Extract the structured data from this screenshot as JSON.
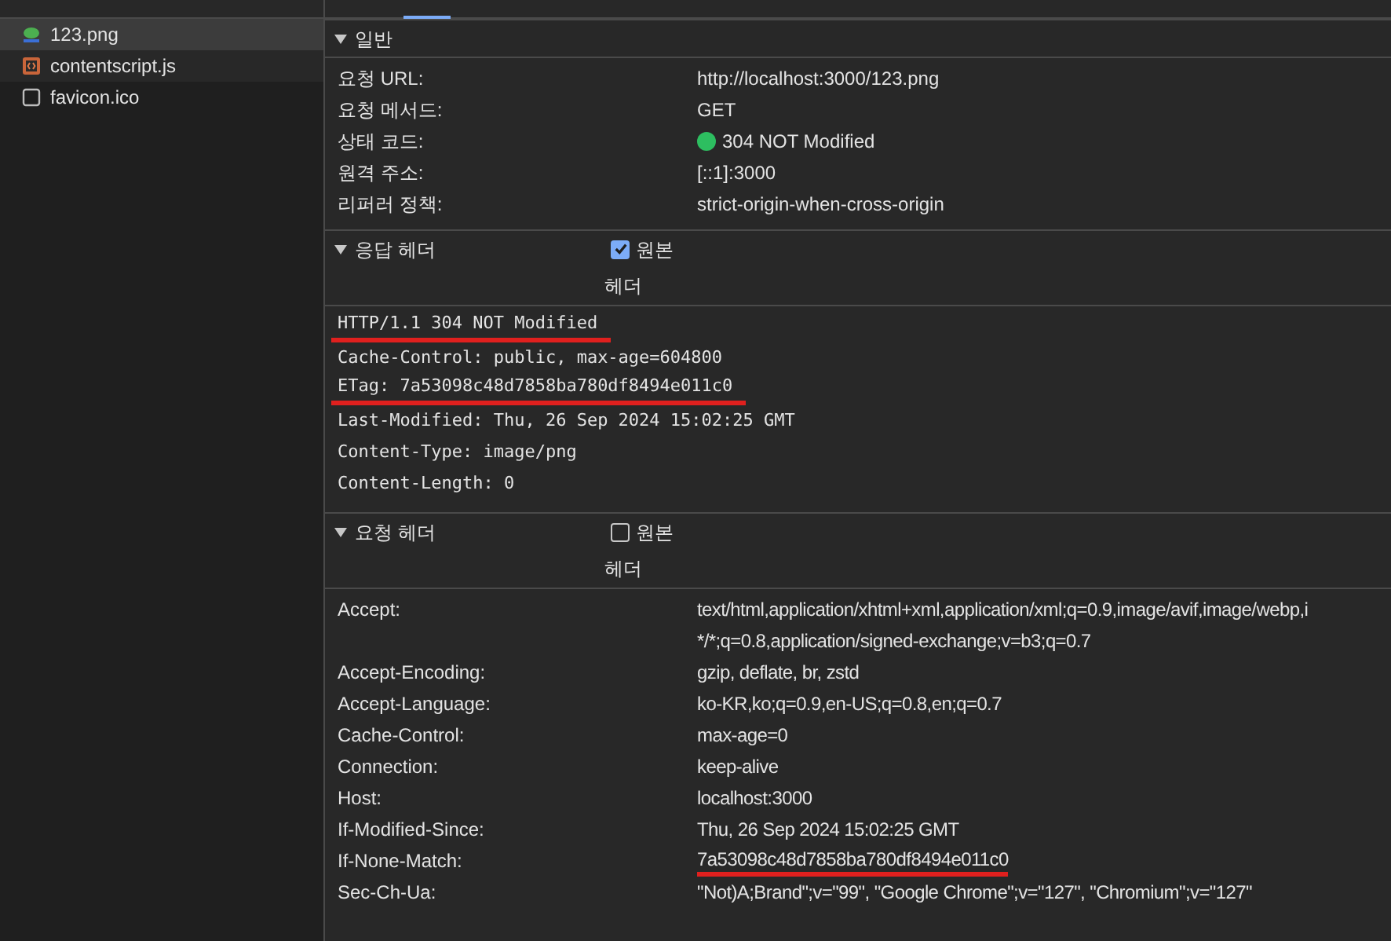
{
  "files": [
    {
      "name": "123.png",
      "kind": "image",
      "selected": true
    },
    {
      "name": "contentscript.js",
      "kind": "script",
      "selected": false
    },
    {
      "name": "favicon.ico",
      "kind": "blank",
      "selected": false
    }
  ],
  "general": {
    "title": "일반",
    "expanded": true,
    "rows": [
      {
        "key": "요청 URL:",
        "value": "http://localhost:3000/123.png"
      },
      {
        "key": "요청 메서드:",
        "value": "GET"
      },
      {
        "key": "상태 코드:",
        "value": "304 NOT Modified",
        "color": "#2dbe60"
      },
      {
        "key": "원격 주소:",
        "value": "[::1]:3000"
      },
      {
        "key": "리퍼러 정책:",
        "value": "strict-origin-when-cross-origin"
      }
    ]
  },
  "response_headers": {
    "title": "응답 헤더",
    "expanded": true,
    "raw_checkbox": {
      "label": "원본",
      "checked": true
    },
    "column_label": "헤더",
    "raw_lines": [
      {
        "text": "HTTP/1.1 304 NOT Modified",
        "underlined": true
      },
      {
        "text": "Cache-Control: public, max-age=604800",
        "underlined": false
      },
      {
        "text": "ETag: 7a53098c48d7858ba780df8494e011c0",
        "underlined": true
      },
      {
        "text": "Last-Modified: Thu, 26 Sep 2024 15:02:25 GMT",
        "underlined": false
      },
      {
        "text": "Content-Type: image/png",
        "underlined": false
      },
      {
        "text": "Content-Length: 0",
        "underlined": false
      }
    ]
  },
  "request_headers": {
    "title": "요청 헤더",
    "expanded": true,
    "raw_checkbox": {
      "label": "원본",
      "checked": false
    },
    "column_label": "헤더",
    "rows": [
      {
        "key": "Accept:",
        "value_lines": [
          "text/html,application/xhtml+xml,application/xml;q=0.9,image/avif,image/webp,i",
          "*/*;q=0.8,application/signed-exchange;v=b3;q=0.7"
        ],
        "underlined": false
      },
      {
        "key": "Accept-Encoding:",
        "value_lines": [
          "gzip, deflate, br, zstd"
        ],
        "underlined": false
      },
      {
        "key": "Accept-Language:",
        "value_lines": [
          "ko-KR,ko;q=0.9,en-US;q=0.8,en;q=0.7"
        ],
        "underlined": false
      },
      {
        "key": "Cache-Control:",
        "value_lines": [
          "max-age=0"
        ],
        "underlined": false
      },
      {
        "key": "Connection:",
        "value_lines": [
          "keep-alive"
        ],
        "underlined": false
      },
      {
        "key": "Host:",
        "value_lines": [
          "localhost:3000"
        ],
        "underlined": false
      },
      {
        "key": "If-Modified-Since:",
        "value_lines": [
          "Thu, 26 Sep 2024 15:02:25 GMT"
        ],
        "underlined": false
      },
      {
        "key": "If-None-Match:",
        "value_lines": [
          "7a53098c48d7858ba780df8494e011c0"
        ],
        "underlined": true
      },
      {
        "key": "Sec-Ch-Ua:",
        "value_lines": [
          "\"Not)A;Brand\";v=\"99\", \"Google Chrome\";v=\"127\", \"Chromium\";v=\"127\""
        ],
        "underlined": false
      }
    ]
  }
}
